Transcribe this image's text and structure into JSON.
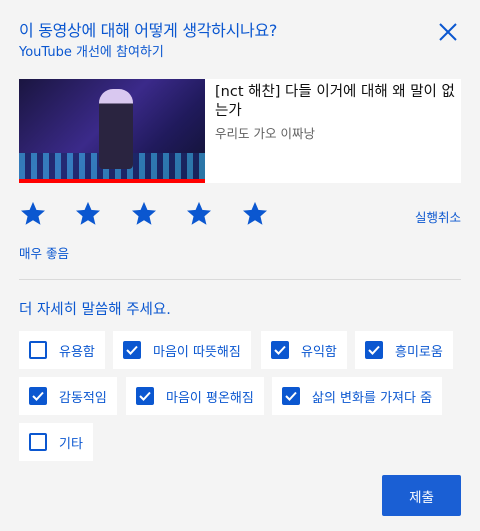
{
  "survey": {
    "question": "이 동영상에 대해 어떻게 생각하시나요?",
    "subtitle": "YouTube 개선에 참여하기",
    "close_icon": "close-icon"
  },
  "video": {
    "title": "[nct 해찬] 다들 이거에 대해 왜 말이 없는가",
    "channel": "우리도 가오 이짜낭",
    "watched_fraction": 1.0
  },
  "rating": {
    "value": 5,
    "max": 5,
    "label": "매우 좋음",
    "undo_label": "실행취소"
  },
  "details": {
    "prompt": "더 자세히 말씀해 주세요.",
    "options": [
      {
        "label": "유용함",
        "checked": false
      },
      {
        "label": "마음이 따뜻해짐",
        "checked": true
      },
      {
        "label": "유익함",
        "checked": true
      },
      {
        "label": "흥미로움",
        "checked": true
      },
      {
        "label": "감동적임",
        "checked": true
      },
      {
        "label": "마음이 평온해짐",
        "checked": true
      },
      {
        "label": "삶의 변화를 가져다 줌",
        "checked": true
      },
      {
        "label": "기타",
        "checked": false
      }
    ]
  },
  "submit_label": "제출",
  "colors": {
    "accent": "#0b57d0",
    "background": "#f4f4f4",
    "progress": "#ff0000"
  }
}
